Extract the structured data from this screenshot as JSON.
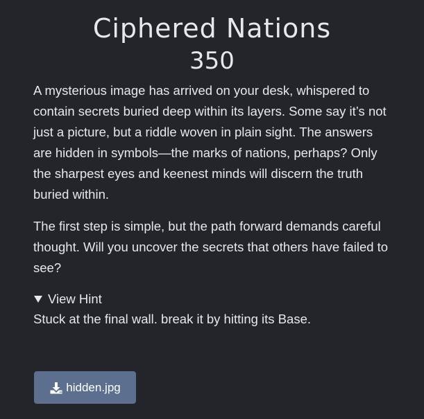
{
  "challenge": {
    "title": "Ciphered Nations",
    "points": "350",
    "description": [
      "A mysterious image has arrived on your desk, whispered to contain secrets buried deep within its layers. Some say it’s not just a picture, but a riddle woven in plain sight. The answers are hidden in symbols—the marks of nations, perhaps? Only the sharpest eyes and keenest minds will discern the truth buried within.",
      "The first step is simple, but the path forward demands careful thought. Will you uncover the secrets that others have failed to see?"
    ],
    "hint": {
      "toggle_label": "View Hint",
      "text": "Stuck at the final wall. break it by hitting its Base."
    },
    "file": {
      "name": "hidden.jpg",
      "icon": "download-icon"
    }
  },
  "colors": {
    "background": "#23252b",
    "text": "#e6e8ec",
    "button": "#5c6f8e"
  }
}
